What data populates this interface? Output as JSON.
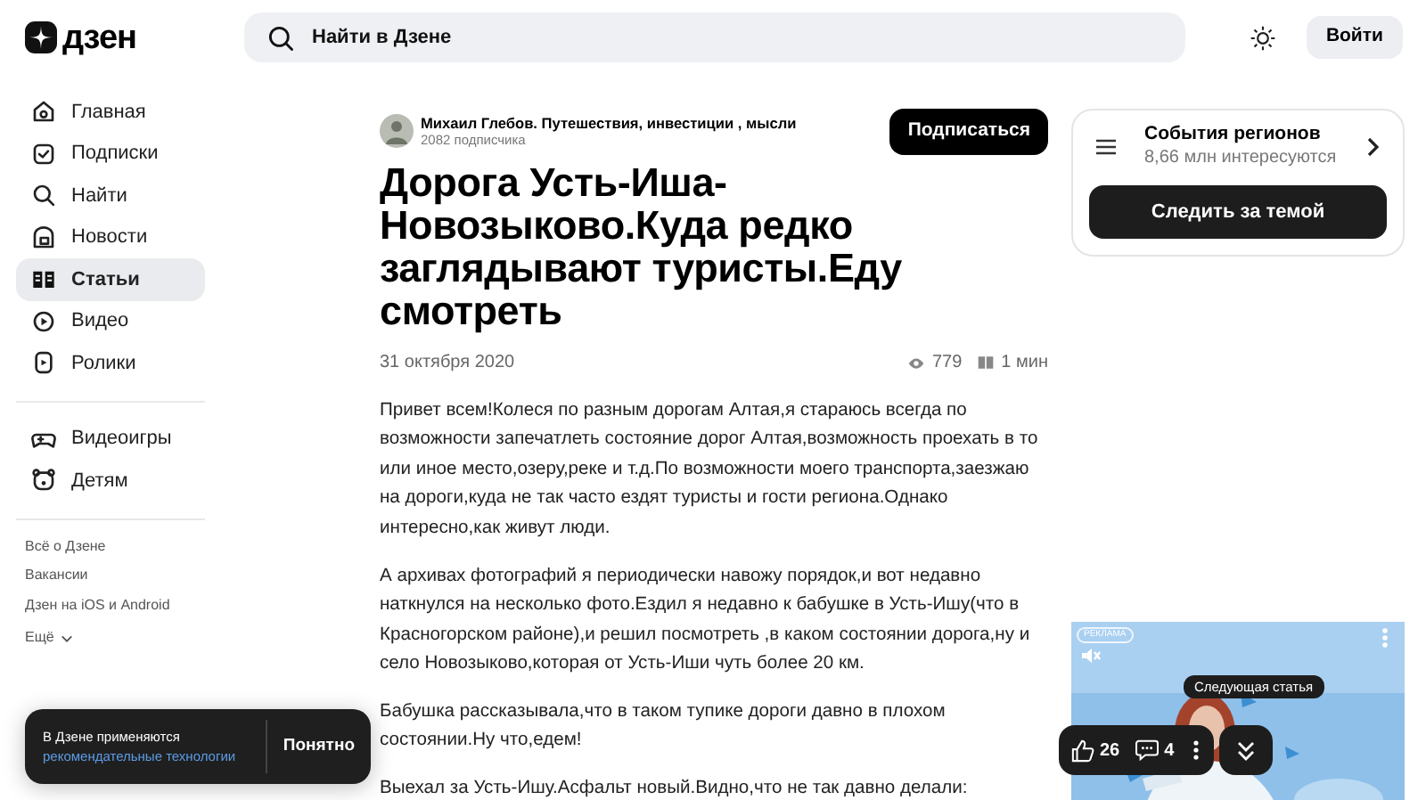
{
  "logo": {
    "text": "дзен"
  },
  "search": {
    "placeholder": "Найти в Дзене"
  },
  "header": {
    "login": "Войти"
  },
  "sidebar": {
    "items": [
      {
        "label": "Главная",
        "kind": "home",
        "selected": false
      },
      {
        "label": "Подписки",
        "kind": "subs",
        "selected": false
      },
      {
        "label": "Найти",
        "kind": "search",
        "selected": false
      },
      {
        "label": "Новости",
        "kind": "news",
        "selected": false
      },
      {
        "label": "Статьи",
        "kind": "book",
        "selected": true
      },
      {
        "label": "Видео",
        "kind": "video",
        "selected": false
      },
      {
        "label": "Ролики",
        "kind": "clips",
        "selected": false
      }
    ],
    "extra_items": [
      {
        "label": "Видеоигры",
        "kind": "gamepad",
        "selected": false
      },
      {
        "label": "Детям",
        "kind": "bear",
        "selected": false
      }
    ],
    "links": [
      "Всё о Дзене",
      "Вакансии",
      "Дзен на iOS и Android"
    ],
    "more": "Ещё"
  },
  "article": {
    "author": "Михаил Глебов. Путешествия, инвестиции , мысли",
    "subscribers": "2082 подписчика",
    "subscribe": "Подписаться",
    "title": "Дорога Усть-Иша-Новозыково.Куда редко заглядывают туристы.Еду смотреть",
    "date": "31 октября 2020",
    "views": "779",
    "read_time": "1 мин",
    "paragraphs": [
      "Привет всем!Колеся по разным дорогам Алтая,я стараюсь всегда по возможности запечатлеть состояние дорог Алтая,возможность проехать в то или иное место,озеру,реке и т.д.По возможности моего транспорта,заезжаю на дороги,куда не так часто ездят туристы и гости региона.Однако интересно,как живут люди.",
      "А архивах фотографий я периодически навожу порядок,и вот недавно наткнулся на несколько фото.Ездил я недавно к бабушке в Усть-Ишу(что в Красногорском районе),и решил посмотреть ,в каком состоянии дорога,ну и село Новозыково,которая от Усть-Иши чуть более 20 км.",
      "Бабушка рассказывала,что в таком тупике дороги давно в плохом состоянии.Ну что,едем!",
      "Выехал за Усть-Ишу.Асфальт новый.Видно,что не так давно делали:"
    ]
  },
  "topic_card": {
    "title": "События регионов",
    "subtitle": "8,66 млн интересуются",
    "button": "Следить за темой"
  },
  "ad": {
    "label": "РЕКЛАМА",
    "kind": "picture"
  },
  "cookie_banner": {
    "text": "В Дзене применяются",
    "link": "рекомендательные технологии",
    "button": "Понятно"
  },
  "action_bar": {
    "likes": "26",
    "comments": "4",
    "tooltip": "Следующая статья"
  }
}
